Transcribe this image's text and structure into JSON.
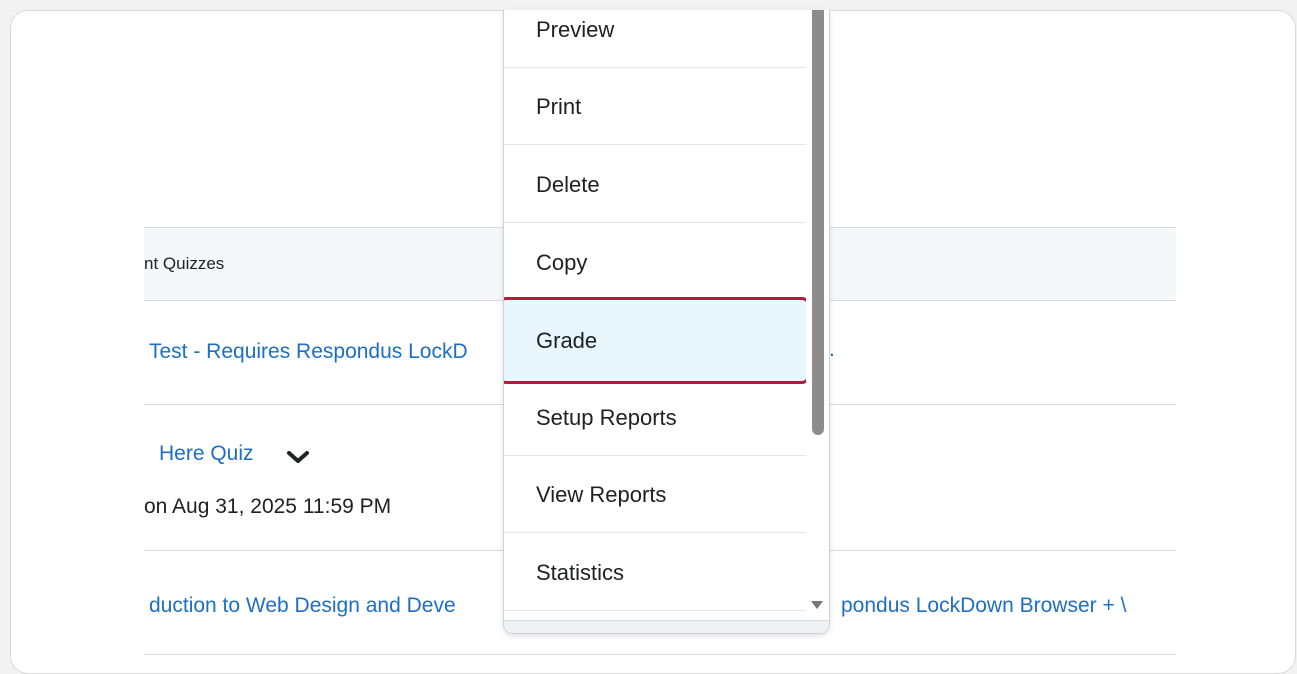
{
  "table": {
    "header_text": "nt Quizzes",
    "rows": [
      {
        "title": "Test - Requires Respondus LockD",
        "title_right": "."
      },
      {
        "title": "Here Quiz",
        "due": "on Aug 31, 2025 11:59 PM"
      },
      {
        "title": "duction to Web Design and Deve",
        "title_right": "pondus LockDown Browser + \\"
      }
    ]
  },
  "menu": {
    "items": [
      "Preview",
      "Print",
      "Delete",
      "Copy",
      "Grade",
      "Setup Reports",
      "View Reports",
      "Statistics"
    ],
    "selected": "Grade"
  },
  "colors": {
    "link": "#1d6fc4",
    "highlight_border": "#b01c3a",
    "highlight_fill": "#e8f6fd"
  }
}
